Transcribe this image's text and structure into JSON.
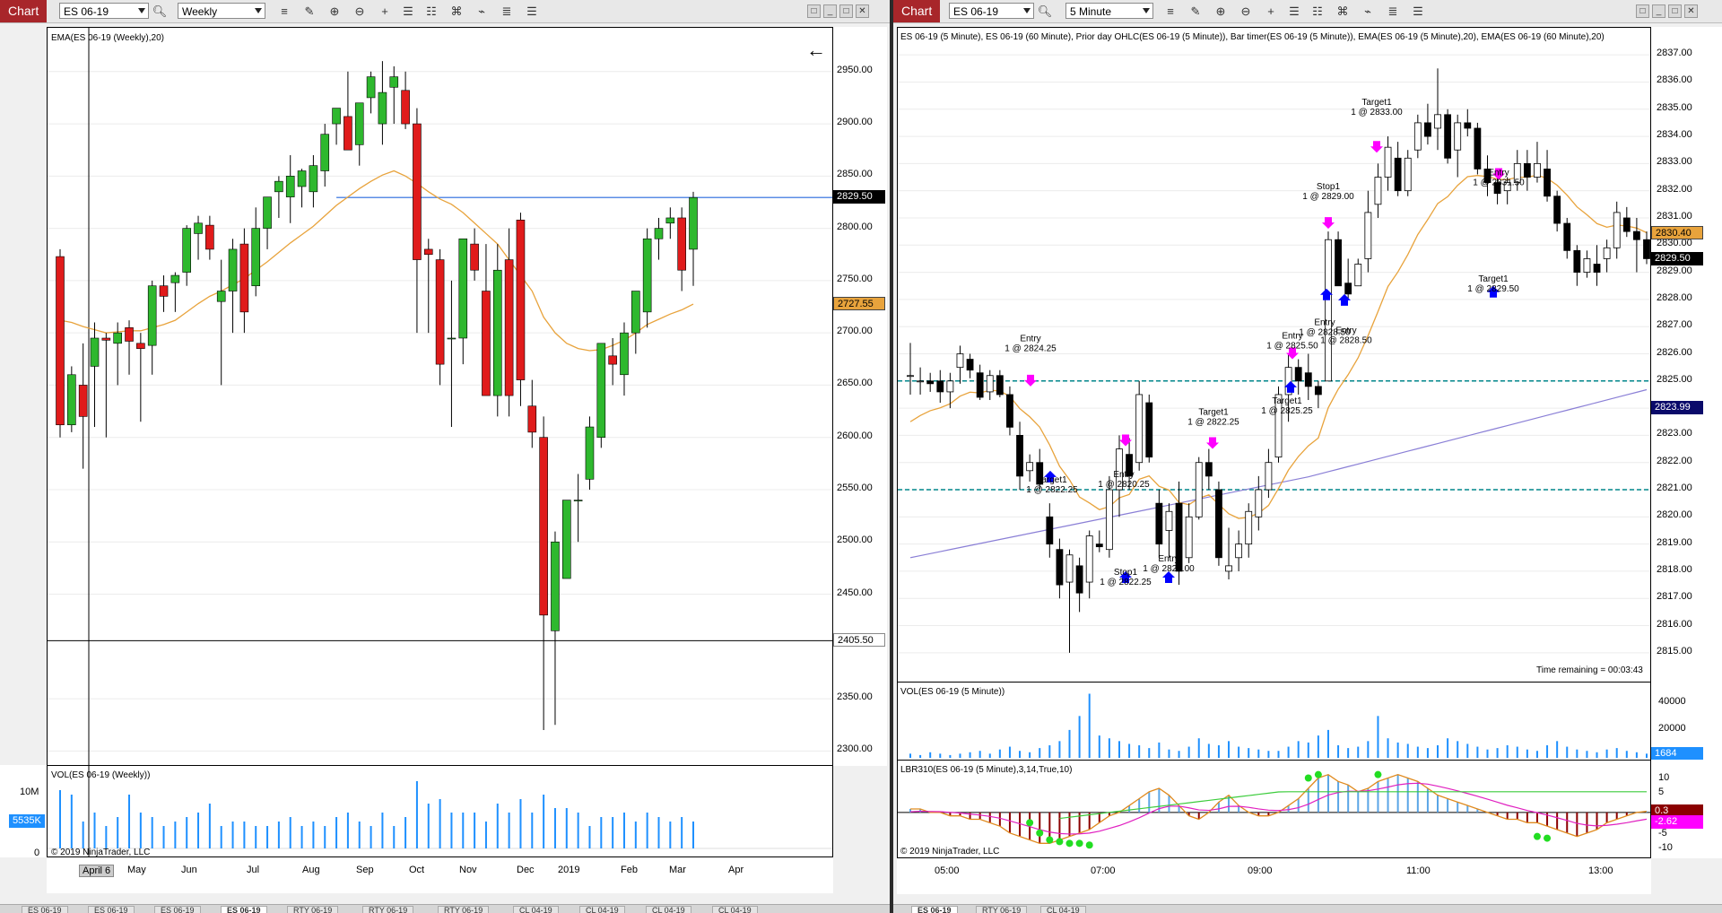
{
  "left": {
    "toolbar": {
      "chart_label": "Chart",
      "instrument": "ES 06-19",
      "interval": "Weekly"
    },
    "price_title": "EMA(ES 06-19 (Weekly),20)",
    "vol_title": "VOL(ES 06-19 (Weekly))",
    "copyright": "© 2019 NinjaTrader, LLC",
    "y_ticks": [
      "2950.00",
      "2900.00",
      "2850.00",
      "2800.00",
      "2750.00",
      "2700.00",
      "2650.00",
      "2600.00",
      "2550.00",
      "2500.00",
      "2450.00",
      "2350.00",
      "2300.00"
    ],
    "tags": {
      "last": "2829.50",
      "ema": "2727.55",
      "crosshair": "2405.50",
      "vol": "5535K"
    },
    "vol_ticks": [
      "10M",
      "0"
    ],
    "x_ticks": [
      "April 6",
      "May",
      "Jun",
      "Jul",
      "Aug",
      "Sep",
      "Oct",
      "Nov",
      "Dec",
      "2019",
      "Feb",
      "Mar",
      "Apr"
    ],
    "tabs": [
      "ES 06-19",
      "ES 06-19",
      "ES 06-19",
      "ES 06-19",
      "RTY 06-19",
      "RTY 06-19",
      "RTY 06-19",
      "CL 04-19",
      "CL 04-19",
      "CL 04-19",
      "CL 04-19"
    ],
    "active_tab": 3
  },
  "right": {
    "toolbar": {
      "chart_label": "Chart",
      "instrument": "ES 06-19",
      "interval": "5 Minute"
    },
    "price_title": "ES 06-19 (5 Minute), ES 06-19 (60 Minute), Prior day OHLC(ES 06-19 (5 Minute)), Bar timer(ES 06-19 (5 Minute)), EMA(ES 06-19 (5 Minute),20), EMA(ES 06-19 (60 Minute),20)",
    "vol_title": "VOL(ES 06-19 (5 Minute))",
    "osc_title": "LBR310(ES 06-19 (5 Minute),3,14,True,10)",
    "copyright": "© 2019 NinjaTrader, LLC",
    "time_remaining": "Time remaining = 00:03:43",
    "y_ticks": [
      "2837.00",
      "2836.00",
      "2835.00",
      "2834.00",
      "2833.00",
      "2832.00",
      "2831.00",
      "2830.00",
      "2829.00",
      "2828.00",
      "2827.00",
      "2826.00",
      "2825.00",
      "2824.00",
      "2823.00",
      "2822.00",
      "2821.00",
      "2820.00",
      "2819.00",
      "2818.00",
      "2817.00",
      "2816.00",
      "2815.00"
    ],
    "tags": {
      "ema5": "2830.40",
      "last": "2829.50",
      "ema60": "2823.99",
      "vol": "1684",
      "osc1": "0.3",
      "osc2": "-2.62"
    },
    "vol_ticks": [
      "40000",
      "20000"
    ],
    "osc_ticks": [
      "10",
      "5",
      "-5",
      "-10"
    ],
    "x_ticks": [
      "05:00",
      "07:00",
      "09:00",
      "11:00",
      "13:00"
    ],
    "annotations": [
      {
        "l1": "Entry",
        "l2": "1 @ 2824.25"
      },
      {
        "l1": "Target1",
        "l2": "1 @ 2822.25"
      },
      {
        "l1": "Entry",
        "l2": "1 @ 2820.25"
      },
      {
        "l1": "Stop1",
        "l2": "1 @ 2822.25"
      },
      {
        "l1": "Entry",
        "l2": "1 @ 2820.00"
      },
      {
        "l1": "Target1",
        "l2": "1 @ 2822.25"
      },
      {
        "l1": "Entry",
        "l2": "1 @ 2825.50"
      },
      {
        "l1": "Target1",
        "l2": "1 @ 2825.25"
      },
      {
        "l1": "Entry",
        "l2": "1 @ 2828.50"
      },
      {
        "l1": "Entry",
        "l2": "1 @ 2828.50"
      },
      {
        "l1": "Stop1",
        "l2": "1 @ 2829.00"
      },
      {
        "l1": "Target1",
        "l2": "1 @ 2833.00"
      },
      {
        "l1": "Entry",
        "l2": "1 @ 2831.50"
      },
      {
        "l1": "Target1",
        "l2": "1 @ 2829.50"
      }
    ],
    "tabs": [
      "ES 06-19",
      "RTY 06-19",
      "CL 04-19"
    ],
    "active_tab": 0
  },
  "colors": {
    "up": "#2eb82e",
    "down": "#e01b1b",
    "ema": "#e8a33c",
    "vol": "#1e90ff",
    "magenta": "#ff00ff",
    "blue_arrow": "#0000ff",
    "ema60": "#8a7fd6",
    "prior_day": "#00868b"
  },
  "chart_data": [
    {
      "type": "candlestick",
      "title": "EMA(ES 06-19 (Weekly),20)",
      "x": [
        "Apr",
        "May",
        "Jun",
        "Jul",
        "Aug",
        "Sep",
        "Oct",
        "Nov",
        "Dec",
        "2019",
        "Feb",
        "Mar",
        "Apr"
      ],
      "ylim": [
        2290,
        2985
      ],
      "last_price": 2829.5,
      "ema_last": 2727.55,
      "bars": [
        [
          2773,
          2780,
          2600,
          2612
        ],
        [
          2612,
          2668,
          2605,
          2660
        ],
        [
          2650,
          2690,
          2570,
          2620
        ],
        [
          2668,
          2710,
          2610,
          2695
        ],
        [
          2695,
          2700,
          2600,
          2693
        ],
        [
          2690,
          2710,
          2650,
          2700
        ],
        [
          2705,
          2712,
          2660,
          2692
        ],
        [
          2690,
          2700,
          2615,
          2685
        ],
        [
          2688,
          2750,
          2660,
          2745
        ],
        [
          2745,
          2755,
          2720,
          2735
        ],
        [
          2748,
          2758,
          2720,
          2755
        ],
        [
          2758,
          2803,
          2745,
          2800
        ],
        [
          2795,
          2812,
          2770,
          2805
        ],
        [
          2803,
          2812,
          2770,
          2780
        ],
        [
          2730,
          2770,
          2650,
          2740
        ],
        [
          2740,
          2790,
          2700,
          2780
        ],
        [
          2785,
          2800,
          2700,
          2720
        ],
        [
          2745,
          2820,
          2735,
          2800
        ],
        [
          2800,
          2830,
          2780,
          2830
        ],
        [
          2835,
          2850,
          2810,
          2845
        ],
        [
          2830,
          2870,
          2805,
          2850
        ],
        [
          2840,
          2857,
          2820,
          2855
        ],
        [
          2835,
          2870,
          2820,
          2860
        ],
        [
          2855,
          2900,
          2840,
          2890
        ],
        [
          2900,
          2915,
          2880,
          2915
        ],
        [
          2907,
          2950,
          2880,
          2875
        ],
        [
          2880,
          2920,
          2860,
          2920
        ],
        [
          2925,
          2950,
          2910,
          2945
        ],
        [
          2900,
          2960,
          2880,
          2930
        ],
        [
          2935,
          2955,
          2900,
          2945
        ],
        [
          2932,
          2950,
          2895,
          2900
        ],
        [
          2900,
          2915,
          2700,
          2770
        ],
        [
          2780,
          2790,
          2700,
          2775
        ],
        [
          2770,
          2780,
          2650,
          2670
        ],
        [
          2695,
          2750,
          2610,
          2695
        ],
        [
          2695,
          2790,
          2670,
          2790
        ],
        [
          2785,
          2800,
          2750,
          2760
        ],
        [
          2740,
          2785,
          2700,
          2640
        ],
        [
          2640,
          2785,
          2620,
          2760
        ],
        [
          2770,
          2800,
          2620,
          2640
        ],
        [
          2808,
          2815,
          2630,
          2655
        ],
        [
          2630,
          2655,
          2590,
          2605
        ],
        [
          2600,
          2620,
          2320,
          2430
        ],
        [
          2415,
          2510,
          2325,
          2500
        ],
        [
          2465,
          2500,
          2510,
          2540
        ],
        [
          2540,
          2565,
          2500,
          2540
        ],
        [
          2560,
          2620,
          2550,
          2610
        ],
        [
          2600,
          2690,
          2590,
          2690
        ],
        [
          2678,
          2695,
          2650,
          2670
        ],
        [
          2660,
          2710,
          2640,
          2700
        ],
        [
          2700,
          2740,
          2680,
          2740
        ],
        [
          2720,
          2800,
          2705,
          2790
        ],
        [
          2790,
          2810,
          2770,
          2800
        ],
        [
          2805,
          2820,
          2790,
          2810
        ],
        [
          2810,
          2820,
          2740,
          2760
        ],
        [
          2780,
          2835,
          2745,
          2829.5
        ]
      ],
      "ema": [
        2712,
        2710,
        2706,
        2703,
        2700,
        2701,
        2702,
        2702,
        2705,
        2708,
        2712,
        2720,
        2728,
        2735,
        2740,
        2746,
        2752,
        2760,
        2768,
        2777,
        2786,
        2794,
        2802,
        2812,
        2822,
        2830,
        2838,
        2845,
        2851,
        2855,
        2850,
        2843,
        2835,
        2828,
        2823,
        2815,
        2805,
        2795,
        2785,
        2770,
        2755,
        2740,
        2715,
        2700,
        2690,
        2685,
        2683,
        2684,
        2688,
        2693,
        2700,
        2708,
        2713,
        2718,
        2722,
        2727.55
      ],
      "volume_millions": [
        13,
        12,
        6,
        8,
        5,
        7,
        12,
        8,
        7,
        5,
        6,
        7,
        8,
        10,
        5,
        6,
        6,
        5,
        5,
        6,
        7,
        5,
        6,
        5,
        7,
        8,
        6,
        5,
        8,
        5,
        7,
        15,
        10,
        11,
        8,
        8,
        8,
        6,
        10,
        8,
        11,
        8,
        12,
        9,
        9,
        8,
        5,
        7,
        7,
        8,
        6,
        8,
        7,
        6,
        7,
        6
      ],
      "volume_last": "5535K"
    },
    {
      "type": "candlestick",
      "title": "ES 06-19 (5 Minute)",
      "x": [
        "05:00",
        "07:00",
        "09:00",
        "11:00",
        "13:00"
      ],
      "ylim": [
        2814.5,
        2837.5
      ],
      "last_price": 2829.5,
      "ema5_last": 2830.4,
      "ema60_last": 2823.99,
      "prior_day_levels": [
        2825.0,
        2821.0
      ],
      "bars": [
        [
          2825.2,
          2826.4,
          2824.5,
          2825.2
        ],
        [
          2825.0,
          2825.5,
          2824.5,
          2825.0
        ],
        [
          2825.0,
          2825.3,
          2824.6,
          2824.9
        ],
        [
          2825.0,
          2825.4,
          2824.2,
          2824.6
        ],
        [
          2824.6,
          2825.3,
          2824.0,
          2825.0
        ],
        [
          2825.5,
          2826.3,
          2824.9,
          2826.0
        ],
        [
          2825.8,
          2826.0,
          2825.1,
          2825.4
        ],
        [
          2825.3,
          2825.6,
          2824.3,
          2824.4
        ],
        [
          2824.6,
          2825.4,
          2824.3,
          2825.2
        ],
        [
          2825.2,
          2825.4,
          2824.4,
          2824.5
        ],
        [
          2824.5,
          2824.8,
          2823.0,
          2823.3
        ],
        [
          2823.0,
          2823.5,
          2821.0,
          2821.5
        ],
        [
          2821.7,
          2822.3,
          2821.3,
          2822.0
        ],
        [
          2822.0,
          2822.5,
          2821.0,
          2821.2
        ],
        [
          2820.0,
          2820.5,
          2818.5,
          2819.0
        ],
        [
          2818.8,
          2819.2,
          2817.0,
          2817.5
        ],
        [
          2817.6,
          2818.8,
          2815.0,
          2818.6
        ],
        [
          2818.2,
          2818.5,
          2816.5,
          2817.2
        ],
        [
          2817.6,
          2819.5,
          2817.0,
          2819.3
        ],
        [
          2819.0,
          2819.5,
          2818.7,
          2818.9
        ],
        [
          2818.8,
          2821.5,
          2818.5,
          2821.0
        ],
        [
          2821.0,
          2823.0,
          2820.0,
          2822.5
        ],
        [
          2822.3,
          2822.9,
          2821.0,
          2821.5
        ],
        [
          2822.0,
          2825.0,
          2821.7,
          2824.5
        ],
        [
          2824.2,
          2824.5,
          2822.0,
          2822.2
        ],
        [
          2820.5,
          2821.0,
          2818.5,
          2819.0
        ],
        [
          2819.5,
          2820.5,
          2818.5,
          2820.2
        ],
        [
          2820.5,
          2821.3,
          2817.5,
          2818.0
        ],
        [
          2818.5,
          2820.5,
          2818.3,
          2820.0
        ],
        [
          2820.0,
          2822.2,
          2819.9,
          2822.0
        ],
        [
          2822.0,
          2822.5,
          2821.0,
          2821.5
        ],
        [
          2821.0,
          2821.3,
          2818.2,
          2818.5
        ],
        [
          2818.0,
          2819.6,
          2817.7,
          2818.2
        ],
        [
          2818.5,
          2819.5,
          2818.0,
          2819.0
        ],
        [
          2819.0,
          2820.5,
          2818.5,
          2820.2
        ],
        [
          2820.0,
          2821.5,
          2819.5,
          2821.0
        ],
        [
          2821.0,
          2822.5,
          2820.7,
          2822.0
        ],
        [
          2822.2,
          2824.8,
          2822.0,
          2824.5
        ],
        [
          2824.5,
          2826.0,
          2823.5,
          2825.5
        ],
        [
          2825.5,
          2825.8,
          2824.5,
          2825.0
        ],
        [
          2825.3,
          2826.0,
          2824.3,
          2824.8
        ],
        [
          2824.8,
          2825.0,
          2824.0,
          2824.5
        ],
        [
          2825.0,
          2830.5,
          2825.0,
          2830.2
        ],
        [
          2830.2,
          2830.5,
          2828.5,
          2828.5
        ],
        [
          2828.6,
          2829.5,
          2828.0,
          2828.2
        ],
        [
          2828.5,
          2829.5,
          2828.5,
          2829.3
        ],
        [
          2829.5,
          2832.0,
          2829.0,
          2831.2
        ],
        [
          2831.5,
          2833.0,
          2831.0,
          2832.5
        ],
        [
          2832.5,
          2834.0,
          2832.0,
          2833.6
        ],
        [
          2833.2,
          2833.8,
          2831.8,
          2832.0
        ],
        [
          2832.0,
          2833.5,
          2831.8,
          2833.2
        ],
        [
          2833.5,
          2834.8,
          2833.2,
          2834.5
        ],
        [
          2834.5,
          2835.2,
          2833.7,
          2834.0
        ],
        [
          2834.3,
          2836.5,
          2833.5,
          2834.8
        ],
        [
          2834.8,
          2835.0,
          2833.0,
          2833.2
        ],
        [
          2833.5,
          2834.8,
          2832.5,
          2834.5
        ],
        [
          2834.5,
          2835.0,
          2834.0,
          2834.3
        ],
        [
          2834.3,
          2834.5,
          2832.6,
          2832.8
        ],
        [
          2832.8,
          2833.3,
          2831.8,
          2832.3
        ],
        [
          2832.3,
          2832.8,
          2831.5,
          2831.9
        ],
        [
          2832.0,
          2832.5,
          2831.5,
          2832.3
        ],
        [
          2832.3,
          2833.5,
          2832.0,
          2833.0
        ],
        [
          2833.0,
          2833.5,
          2832.0,
          2832.5
        ],
        [
          2832.5,
          2833.8,
          2832.3,
          2833.0
        ],
        [
          2832.8,
          2833.5,
          2831.6,
          2831.8
        ],
        [
          2831.8,
          2832.0,
          2830.5,
          2830.8
        ],
        [
          2830.8,
          2831.0,
          2829.5,
          2829.8
        ],
        [
          2829.8,
          2830.0,
          2828.5,
          2829.0
        ],
        [
          2829.0,
          2829.8,
          2828.8,
          2829.5
        ],
        [
          2829.3,
          2830.0,
          2828.5,
          2829.0
        ],
        [
          2829.5,
          2830.2,
          2829.0,
          2829.9
        ],
        [
          2829.9,
          2831.6,
          2829.5,
          2831.2
        ],
        [
          2831.0,
          2831.4,
          2830.3,
          2830.5
        ],
        [
          2830.5,
          2831.0,
          2829.0,
          2830.2
        ],
        [
          2830.2,
          2830.5,
          2829.3,
          2829.5
        ]
      ],
      "volume_last": "1684",
      "volume_range": [
        0,
        45000
      ],
      "oscillator_ylim": [
        -11,
        13
      ],
      "oscillator_last": [
        "0.3",
        "-2.62"
      ]
    }
  ]
}
